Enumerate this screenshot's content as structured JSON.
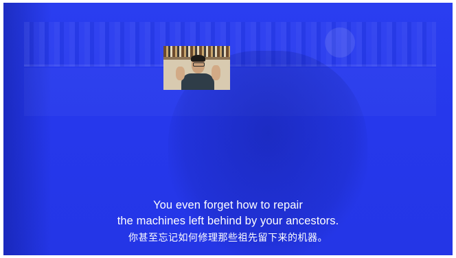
{
  "video": {
    "subtitle_en_line1": "You even forget how to repair",
    "subtitle_en_line2": "the machines left behind by your ancestors.",
    "subtitle_zh": "你甚至忘记如何修理那些祖先留下来的机器。",
    "overlay_color": "#2a3ef0"
  },
  "thumbnail": {
    "icon": "person-video-thumbnail"
  }
}
